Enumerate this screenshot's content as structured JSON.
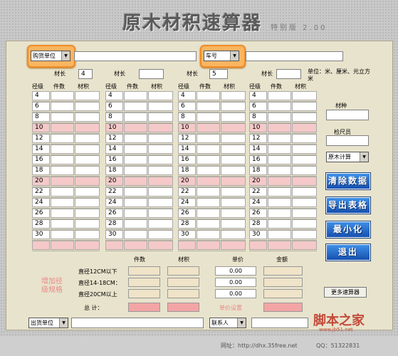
{
  "app": {
    "title": "原木材积速算器",
    "version": "特别版 2.00"
  },
  "top": {
    "buyer_select": "购货单位",
    "buyer_value": "",
    "truck_select": "车号",
    "truck_value": ""
  },
  "lengths": {
    "label": "材长",
    "values": [
      "4",
      "",
      "5",
      ""
    ],
    "unit_note": "单位：米、厘米、元立方米"
  },
  "table": {
    "headers": {
      "dia": "径级",
      "count": "件数",
      "volume": "材积"
    },
    "rows": [
      "4",
      "6",
      "8",
      "10",
      "12",
      "14",
      "16",
      "18",
      "20",
      "22",
      "24",
      "26",
      "28",
      "30"
    ]
  },
  "right": {
    "species_label": "材种",
    "species_value": "",
    "inspector_label": "检尺员",
    "inspector_value": "",
    "calc_select": "原木计算"
  },
  "buttons": {
    "clear": "清除数据",
    "export": "导出表格",
    "minimize": "最小化",
    "exit": "退出",
    "more": "更多速算器"
  },
  "summary": {
    "headers": {
      "count": "件数",
      "volume": "材积",
      "price": "单价",
      "amount": "金额"
    },
    "rows": [
      {
        "label": "直径12CM以下",
        "price": "0.00"
      },
      {
        "label": "直径14-18CM：",
        "price": "0.00"
      },
      {
        "label": "直径20CM以上",
        "price": "0.00"
      }
    ],
    "total_label": "总  计：",
    "add_spec": "增加径级规格",
    "price_setting": "单价设置"
  },
  "bottom": {
    "seller_select": "出货单位",
    "seller_value": "",
    "contact_select": "联系人",
    "contact_value": ""
  },
  "footer": {
    "site": "网址：http://dhx.35free.net",
    "qq": "QQ：51322831"
  },
  "watermark": {
    "text": "脚本之家",
    "url": "www.jb51.net"
  },
  "colors": {
    "accent_orange": "#f08c28",
    "button_blue": "#1f66cc",
    "pink_row": "#f6c9c9",
    "panel": "#e8e3cc"
  }
}
